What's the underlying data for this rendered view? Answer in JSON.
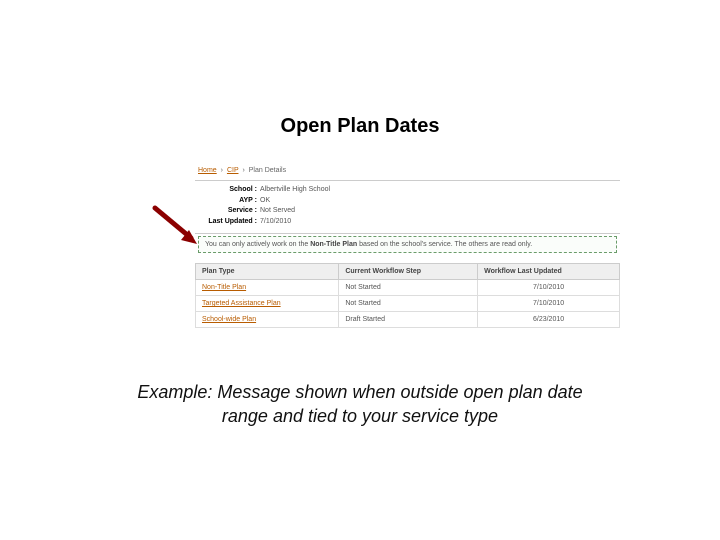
{
  "slide": {
    "title": "Open Plan Dates",
    "caption": "Example: Message shown when outside open plan date range and tied to your service type"
  },
  "breadcrumb": {
    "home": "Home",
    "cip": "CIP",
    "current": "Plan Details"
  },
  "details": {
    "school_label": "School :",
    "school_value": "Albertville High School",
    "ayp_label": "AYP :",
    "ayp_value": "OK",
    "service_label": "Service :",
    "service_value": "Not Served",
    "updated_label": "Last Updated :",
    "updated_value": "7/10/2010"
  },
  "notice": {
    "pre": "You can only actively work on the ",
    "emph": "Non-Title Plan",
    "post": " based on the school's service. The others are read only."
  },
  "table": {
    "headers": {
      "type": "Plan Type",
      "step": "Current Workflow Step",
      "updated": "Workflow Last Updated"
    },
    "rows": [
      {
        "type": "Non-Title Plan",
        "step": "Not Started",
        "updated": "7/10/2010"
      },
      {
        "type": "Targeted Assistance Plan",
        "step": "Not Started",
        "updated": "7/10/2010"
      },
      {
        "type": "School-wide Plan",
        "step": "Draft Started",
        "updated": "6/23/2010"
      }
    ]
  }
}
